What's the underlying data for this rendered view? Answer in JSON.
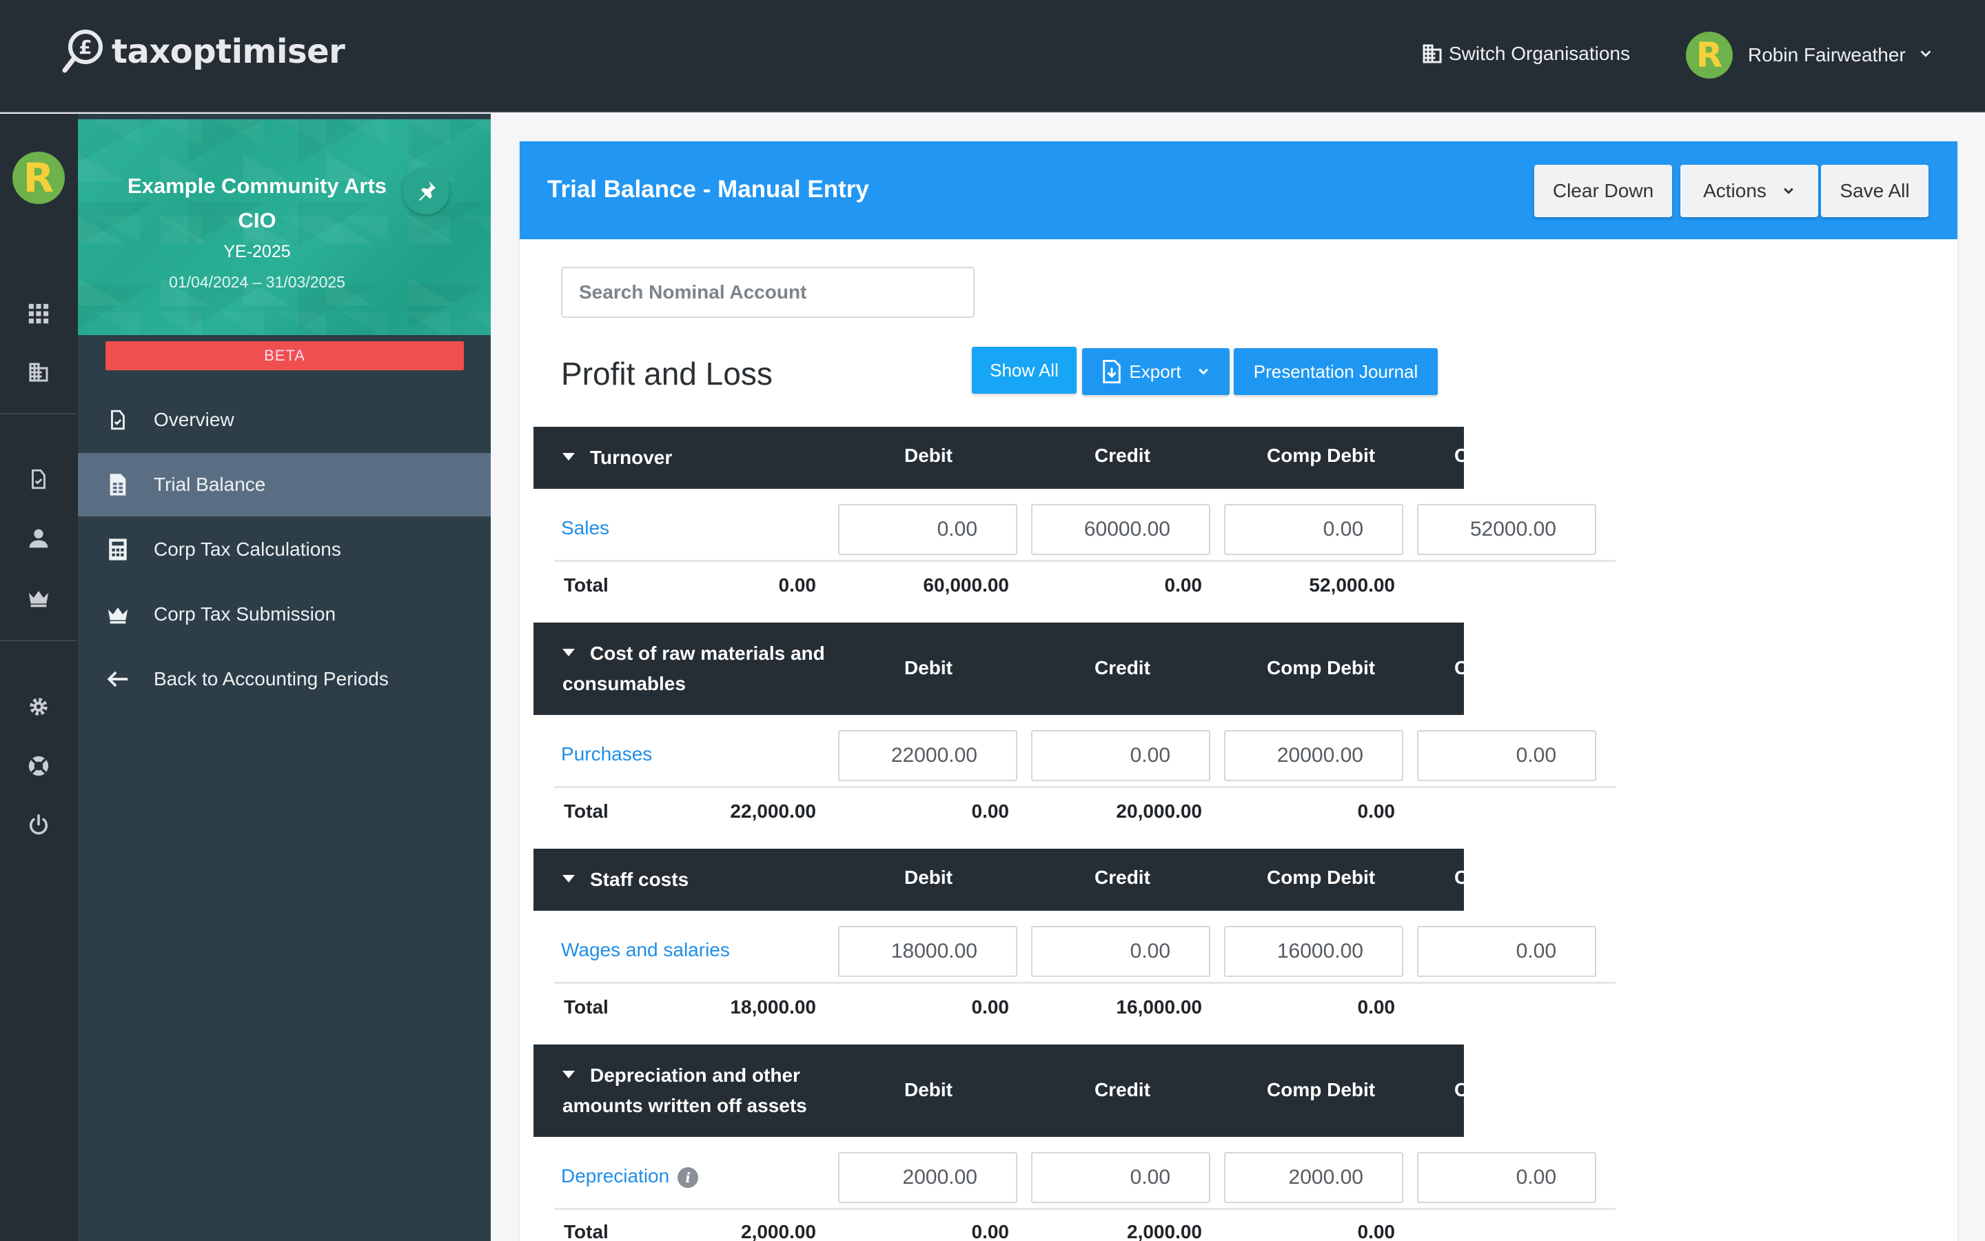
{
  "app": {
    "logo_text": "taxoptimiser"
  },
  "topbar": {
    "switch_org_label": "Switch Organisations",
    "user_name": "Robin Fairweather",
    "avatar_letter": "R"
  },
  "rail": {
    "avatar_letter": "R"
  },
  "sidebar": {
    "org_name": "Example Community Arts CIO",
    "year_end": "YE-2025",
    "period": "01/04/2024 – 31/03/2025",
    "beta_label": "BETA",
    "items": [
      {
        "label": "Overview",
        "icon": "document-check-icon"
      },
      {
        "label": "Trial Balance",
        "icon": "spreadsheet-icon",
        "active": true
      },
      {
        "label": "Corp Tax Calculations",
        "icon": "calculator-icon"
      },
      {
        "label": "Corp Tax Submission",
        "icon": "crown-icon"
      },
      {
        "label": "Back to Accounting Periods",
        "icon": "arrow-left-icon"
      }
    ]
  },
  "panel": {
    "title": "Trial Balance - Manual Entry",
    "clear_down": "Clear Down",
    "actions": "Actions",
    "save_all": "Save All",
    "search_placeholder": "Search Nominal Account",
    "section_title": "Profit and Loss",
    "show_all": "Show All",
    "export": "Export",
    "presentation_journal": "Presentation Journal"
  },
  "columns": {
    "debit": "Debit",
    "credit": "Credit",
    "comp_debit": "Comp Debit",
    "comp_credit_partial": "C"
  },
  "groups": [
    {
      "name": "Turnover",
      "account": "Sales",
      "values": [
        "0.00",
        "60000.00",
        "0.00",
        "52000.00"
      ],
      "total_label": "Total",
      "totals": [
        "0.00",
        "60,000.00",
        "0.00",
        "52,000.00"
      ]
    },
    {
      "name": "Cost of raw materials and consumables",
      "name_line1": "Cost of raw materials and",
      "name_line2": "consumables",
      "account": "Purchases",
      "values": [
        "22000.00",
        "0.00",
        "20000.00",
        "0.00"
      ],
      "total_label": "Total",
      "totals": [
        "22,000.00",
        "0.00",
        "20,000.00",
        "0.00"
      ]
    },
    {
      "name": "Staff costs",
      "account": "Wages and salaries",
      "values": [
        "18000.00",
        "0.00",
        "16000.00",
        "0.00"
      ],
      "total_label": "Total",
      "totals": [
        "18,000.00",
        "0.00",
        "16,000.00",
        "0.00"
      ]
    },
    {
      "name": "Depreciation and other amounts written off assets",
      "name_line1": "Depreciation and other",
      "name_line2": "amounts written off assets",
      "account": "Depreciation",
      "values": [
        "2000.00",
        "0.00",
        "2000.00",
        "0.00"
      ],
      "total_label": "Total",
      "totals": [
        "2,000.00",
        "0.00",
        "2,000.00",
        "0.00"
      ]
    }
  ],
  "colors": {
    "topbar": "#262e35",
    "sidebar": "#2d3e48",
    "accent": "#2196f3",
    "org_card": "#2fb39a",
    "beta": "#ef4f4f",
    "link": "#1f8ee8"
  }
}
